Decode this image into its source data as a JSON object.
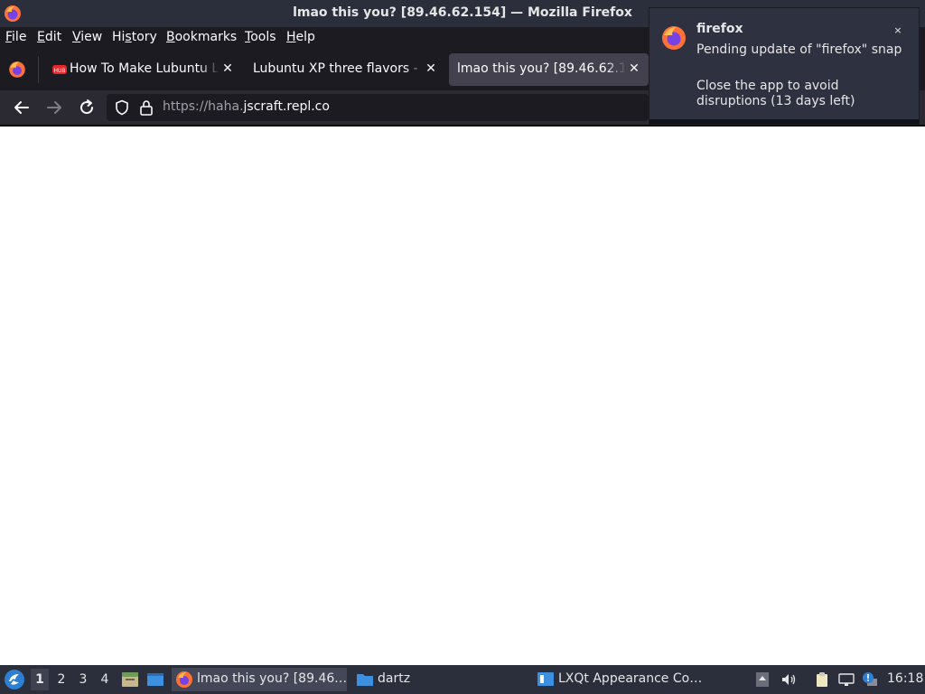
{
  "window": {
    "title": "lmao this you? [89.46.62.154] — Mozilla Firefox",
    "app_icon": "firefox-icon"
  },
  "menubar": {
    "items": [
      {
        "label": "File",
        "mnemonic": "F"
      },
      {
        "label": "Edit",
        "mnemonic": "E"
      },
      {
        "label": "View",
        "mnemonic": "V"
      },
      {
        "label": "History",
        "mnemonic": "s"
      },
      {
        "label": "Bookmarks",
        "mnemonic": "B"
      },
      {
        "label": "Tools",
        "mnemonic": "T"
      },
      {
        "label": "Help",
        "mnemonic": "H"
      }
    ]
  },
  "tabs": [
    {
      "title": "How To Make Lubuntu Lo",
      "favicon": "hub-icon",
      "active": false
    },
    {
      "title": "Lubuntu XP three flavors - E",
      "favicon": "none",
      "active": false
    },
    {
      "title": "lmao this you? [89.46.62.15",
      "favicon": "none",
      "active": true
    }
  ],
  "urlbar": {
    "url_prefix": "https://haha.",
    "url_domain": "jscraft.repl.co"
  },
  "notification": {
    "app": "firefox",
    "body1": "Pending update of \"firefox\" snap",
    "body2": "Close the app to avoid disruptions (13 days left)",
    "close_label": "×"
  },
  "taskbar": {
    "workspaces": [
      "1",
      "2",
      "3",
      "4"
    ],
    "active_workspace": "1",
    "tasks": [
      {
        "label": "lmao this you? [89.46.…",
        "icon": "firefox-icon",
        "active": true
      },
      {
        "label": "dartz",
        "icon": "folder-icon",
        "active": false
      },
      {
        "label": "LXQt Appearance Co…",
        "icon": "appearance-icon",
        "active": false
      }
    ],
    "clock": "16:18"
  },
  "colors": {
    "titlebar_bg": "#2b2e3b",
    "toolbar_bg": "#1c1b22",
    "navbar_bg": "#2b2a33",
    "active_tab_bg": "#42414d",
    "notification_bg": "#2e3240",
    "taskbar_bg": "#2b2e3b"
  }
}
